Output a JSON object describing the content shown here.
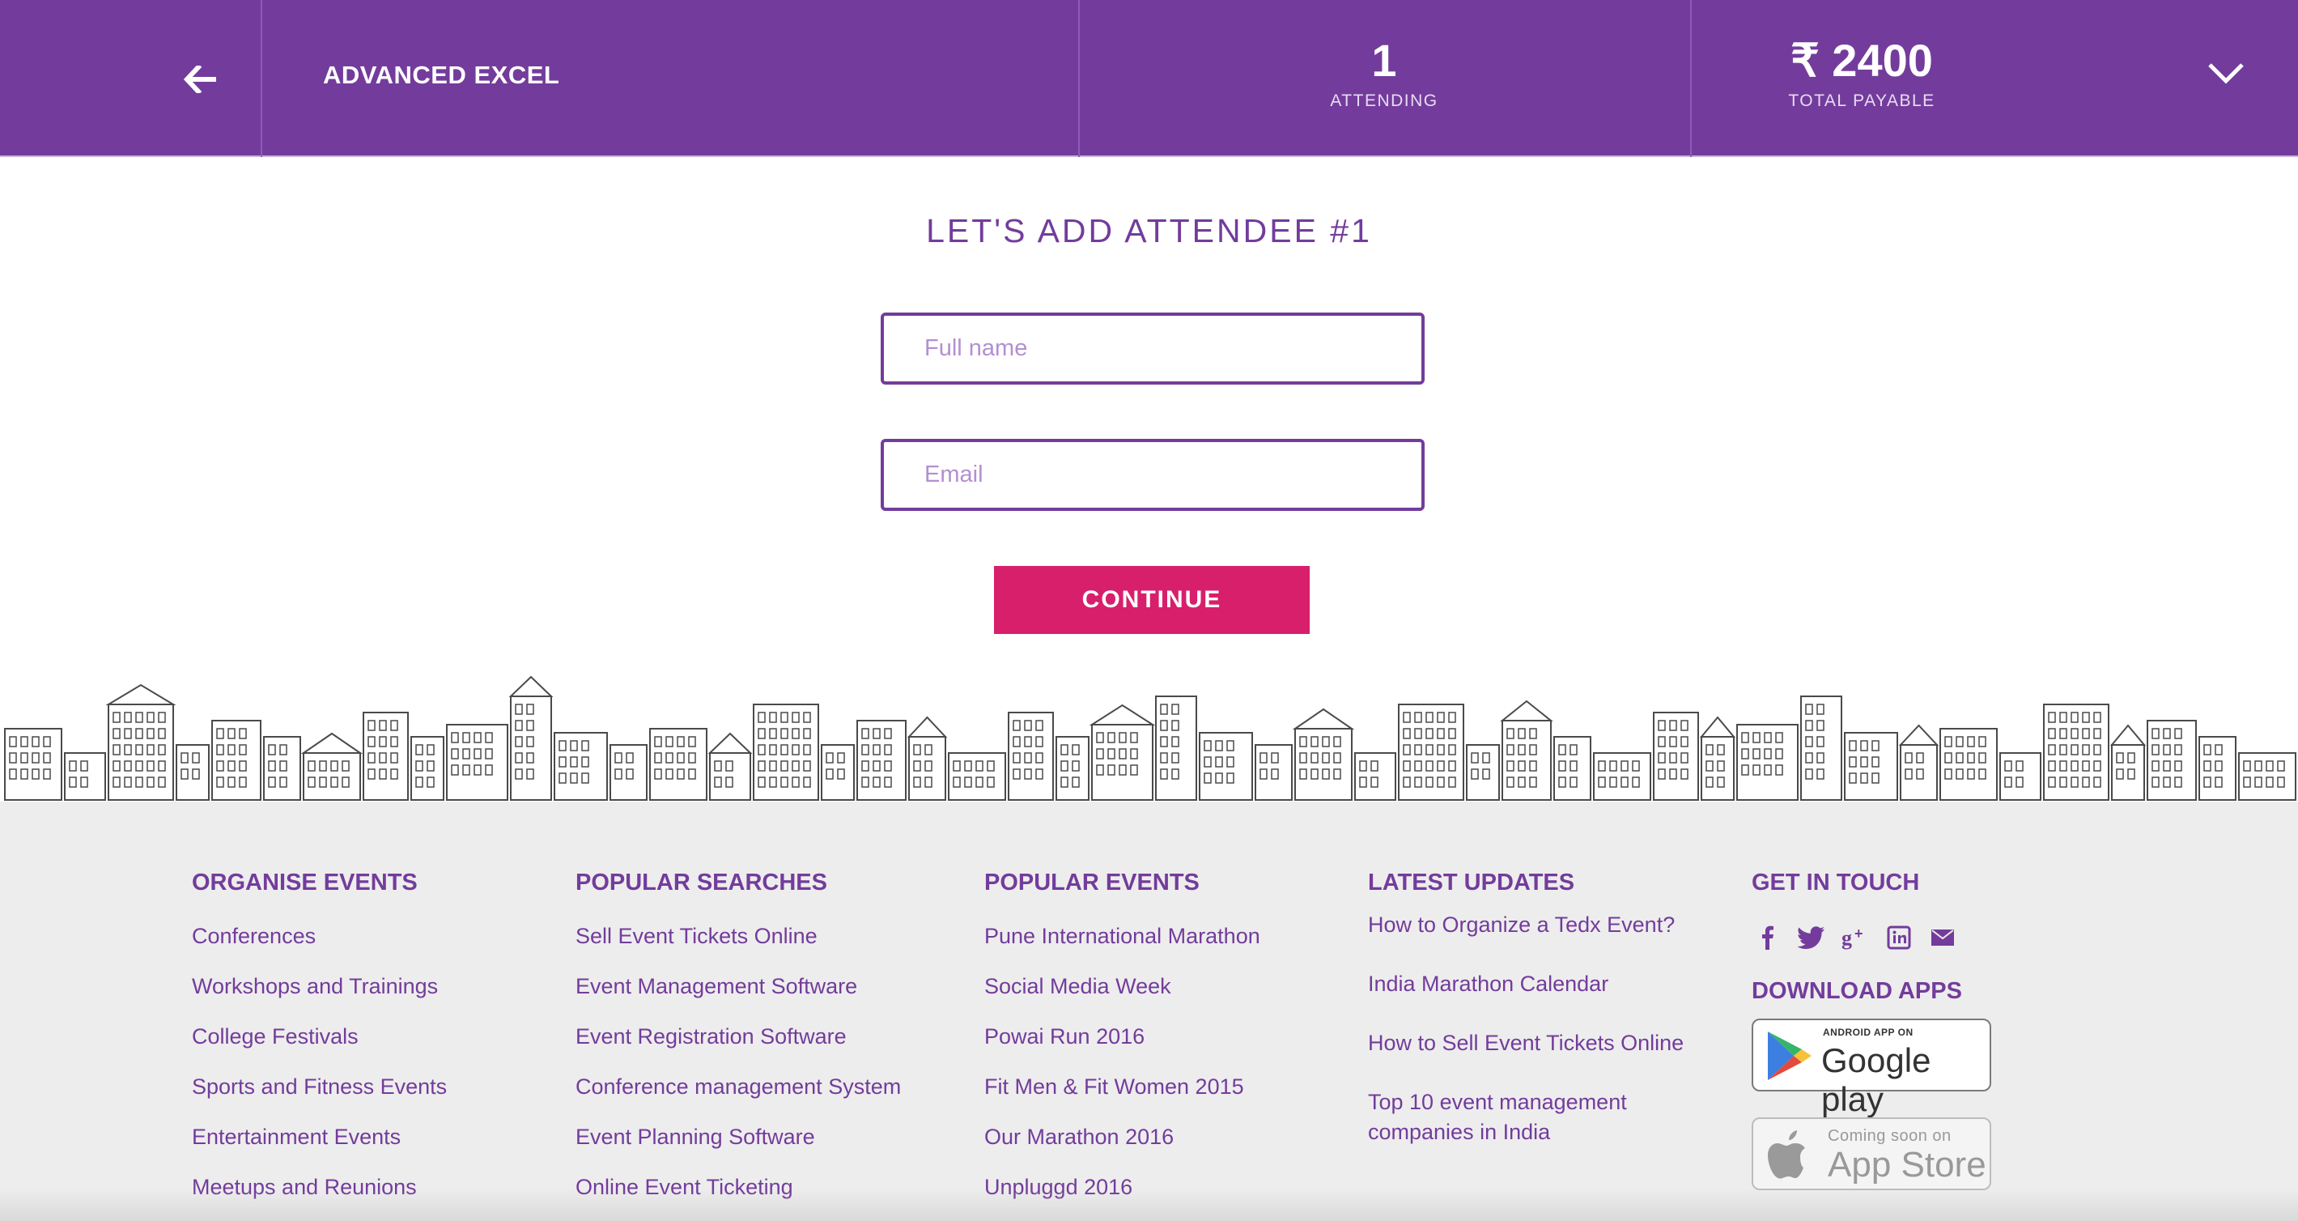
{
  "header": {
    "event_title": "ADVANCED EXCEL",
    "attending_count": "1",
    "attending_label": "ATTENDING",
    "total_amount": "₹ 2400",
    "total_label": "TOTAL PAYABLE",
    "back_icon": "arrow-left-icon",
    "expand_icon": "chevron-down-icon",
    "bg_color": "#733c9c"
  },
  "form": {
    "title": "LET'S ADD ATTENDEE #1",
    "full_name_placeholder": "Full name",
    "full_name_value": "",
    "email_placeholder": "Email",
    "email_value": "",
    "continue_label": "CONTINUE",
    "continue_color": "#d81f6b"
  },
  "footer": {
    "organise": {
      "heading": "ORGANISE EVENTS",
      "links": [
        "Conferences",
        "Workshops and Trainings",
        "College Festivals",
        "Sports and Fitness Events",
        "Entertainment Events",
        "Meetups and Reunions"
      ]
    },
    "searches": {
      "heading": "POPULAR SEARCHES",
      "links": [
        "Sell Event Tickets Online",
        "Event Management Software",
        "Event Registration Software",
        "Conference management System",
        "Event Planning Software",
        "Online Event Ticketing"
      ]
    },
    "events": {
      "heading": "POPULAR EVENTS",
      "links": [
        "Pune International Marathon",
        "Social Media Week",
        "Powai Run 2016",
        "Fit Men & Fit Women 2015",
        "Our Marathon 2016",
        "Unpluggd 2016"
      ]
    },
    "updates": {
      "heading": "LATEST UPDATES",
      "links": [
        "How to Organize a Tedx Event?",
        "India Marathon Calendar",
        "How to Sell Event Tickets Online",
        "Top 10 event management companies in India"
      ]
    },
    "contact": {
      "heading": "GET IN TOUCH",
      "social_icons": [
        "facebook-icon",
        "twitter-icon",
        "google-plus-icon",
        "linkedin-icon",
        "mail-icon"
      ],
      "apps_heading": "DOWNLOAD APPS",
      "google_play_small": "ANDROID APP ON",
      "google_play_big": "Google play",
      "app_store_small": "Coming soon on",
      "app_store_big": "App Store"
    }
  }
}
